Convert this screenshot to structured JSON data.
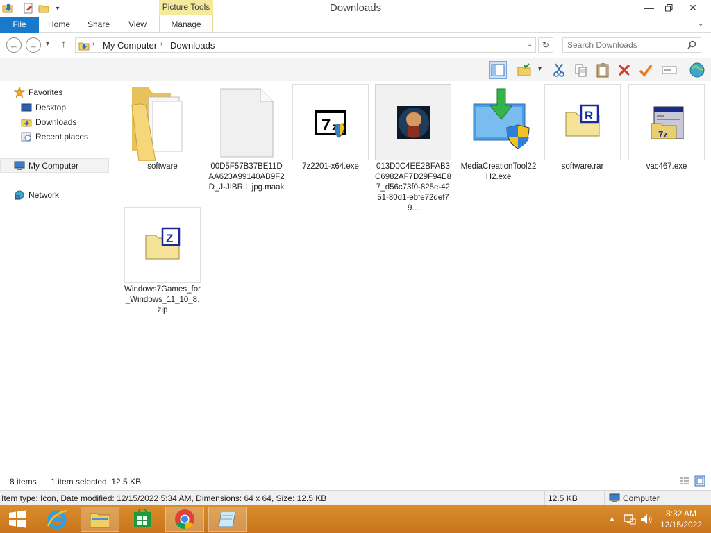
{
  "window": {
    "title": "Downloads",
    "contextual_tab_group": "Picture Tools",
    "controls": [
      "minimize-icon",
      "restore-icon",
      "close-icon"
    ]
  },
  "ribbon": {
    "tabs": [
      {
        "label": "File",
        "active": true
      },
      {
        "label": "Home"
      },
      {
        "label": "Share"
      },
      {
        "label": "View"
      },
      {
        "label": "Manage"
      }
    ]
  },
  "address": {
    "crumbs": [
      "My Computer",
      "Downloads"
    ],
    "search_placeholder": "Search Downloads"
  },
  "nav_pane": {
    "favorites": "Favorites",
    "favorite_items": [
      "Desktop",
      "Downloads",
      "Recent places"
    ],
    "computer": "My Computer",
    "network": "Network"
  },
  "files": [
    {
      "name": "software",
      "type": "folder"
    },
    {
      "name": "00D5F57B37BE11DAA623A99140AB9F2D_J-JIBRIL.jpg.maak",
      "type": "blank-file"
    },
    {
      "name": "7z2201-x64.exe",
      "type": "7zip-installer"
    },
    {
      "name": "013D0C4EE2BFAB3C6982AF7D29F94E87_d56c73f0-825e-4251-80d1-ebfe72def79...",
      "type": "icon-image",
      "selected": true
    },
    {
      "name": "MediaCreationTool22H2.exe",
      "type": "media-creation-tool"
    },
    {
      "name": "software.rar",
      "type": "rar-archive"
    },
    {
      "name": "vac467.exe",
      "type": "7z-setup"
    },
    {
      "name": "Windows7Games_for_Windows_11_10_8.zip",
      "type": "zip-archive"
    }
  ],
  "status": {
    "item_count": "8 items",
    "selection": "1 item selected  12.5 KB",
    "details": "Item type: Icon, Date modified: 12/15/2022 5:34 AM, Dimensions: 64 x 64, Size: 12.5 KB",
    "size": "12.5 KB",
    "location": "Computer"
  },
  "taskbar": {
    "apps": [
      "start-button",
      "internet-explorer",
      "file-explorer",
      "store",
      "chrome",
      "notepad"
    ],
    "time": "8:32 AM",
    "date": "12/15/2022"
  },
  "colors": {
    "file_tab": "#1979ca",
    "picture_tools": "#f3ea9b",
    "taskbar": "#d0802a",
    "selection": "#f1f1f1"
  }
}
